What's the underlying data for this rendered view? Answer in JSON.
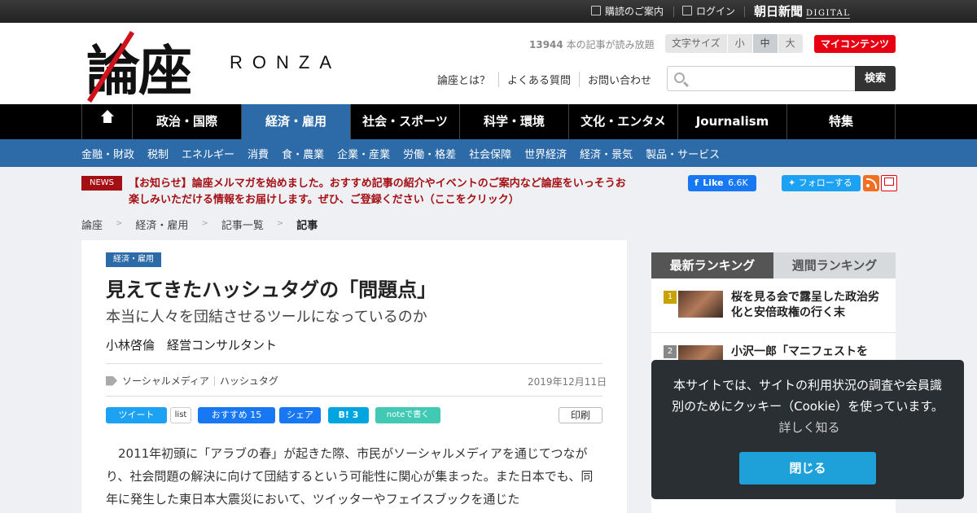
{
  "topbar": {
    "subscribe": "購読のご案内",
    "login": "ログイン",
    "asahi_logo": "朝日新聞",
    "digital": "DIGITAL"
  },
  "header": {
    "logo_kanji": "論座",
    "logo_roman": "RONZA",
    "count_number": "13944",
    "count_text": "本の記事が読み放題",
    "fontsize_label": "文字サイズ",
    "fontsize_options": [
      "小",
      "中",
      "大"
    ],
    "fontsize_selected": "中",
    "my_content": "マイコンテンツ",
    "links": [
      "論座とは？",
      "よくある質問",
      "お問い合わせ"
    ],
    "search_placeholder": "",
    "search_button": "検索"
  },
  "nav": {
    "items": [
      "政治・国際",
      "経済・雇用",
      "社会・スポーツ",
      "科学・環境",
      "文化・エンタメ",
      "Journalism",
      "特集"
    ],
    "active": "経済・雇用"
  },
  "subnav": {
    "items": [
      "金融・財政",
      "税制",
      "エネルギー",
      "消費",
      "食・農業",
      "企業・産業",
      "労働・格差",
      "社会保障",
      "世界経済",
      "経済・景気",
      "製品・サービス"
    ]
  },
  "news": {
    "badge": "NEWS",
    "text": "【お知らせ】論座メルマガを始めました。おすすめ記事の紹介やイベントのご案内など論座をいっそうお楽しみいただける情報をお届けします。ぜひ、ご登録ください（ここをクリック）"
  },
  "social": {
    "fb_like": "Like",
    "fb_count": "6.6K",
    "tw_follow": "フォローする"
  },
  "breadcrumb": [
    "論座",
    "経済・雇用",
    "記事一覧",
    "記事"
  ],
  "article": {
    "category": "経済・雇用",
    "title": "見えてきたハッシュタグの「問題点」",
    "subtitle": "本当に人々を団結させるツールになっているのか",
    "author": "小林啓倫　経営コンサルタント",
    "tags": [
      "ソーシャルメディア",
      "ハッシュタグ"
    ],
    "date": "2019年12月11日",
    "share": {
      "tweet": "ツイート",
      "list": "list",
      "fb_recommend": "おすすめ 15",
      "fb_share": "シェア",
      "hatena": "B! 3",
      "note": "noteで書く",
      "print": "印刷"
    },
    "body": "2011年初頭に「アラブの春」が起きた際、市民がソーシャルメディアを通じてつながり、社会問題の解決に向けて団結するという可能性に関心が集まった。また日本でも、同年に発生した東日本大震災において、ツイッターやフェイスブックを通じた"
  },
  "ranking": {
    "tabs": [
      "最新ランキング",
      "週間ランキング"
    ],
    "items": [
      {
        "rank": "1",
        "title": "桜を見る会で露呈した政治劣化と安倍政権の行く末"
      },
      {
        "rank": "2",
        "title": "小沢一郎「マニフェストを"
      }
    ]
  },
  "cookie": {
    "text": "本サイトでは、サイトの利用状況の調査や会員識別のためにクッキー（Cookie）を使っています。",
    "more": "詳しく知る",
    "close": "閉じる"
  },
  "colors": {
    "accent_blue": "#2d6aa8",
    "brand_red": "#e60012",
    "news_red": "#a40f14"
  }
}
